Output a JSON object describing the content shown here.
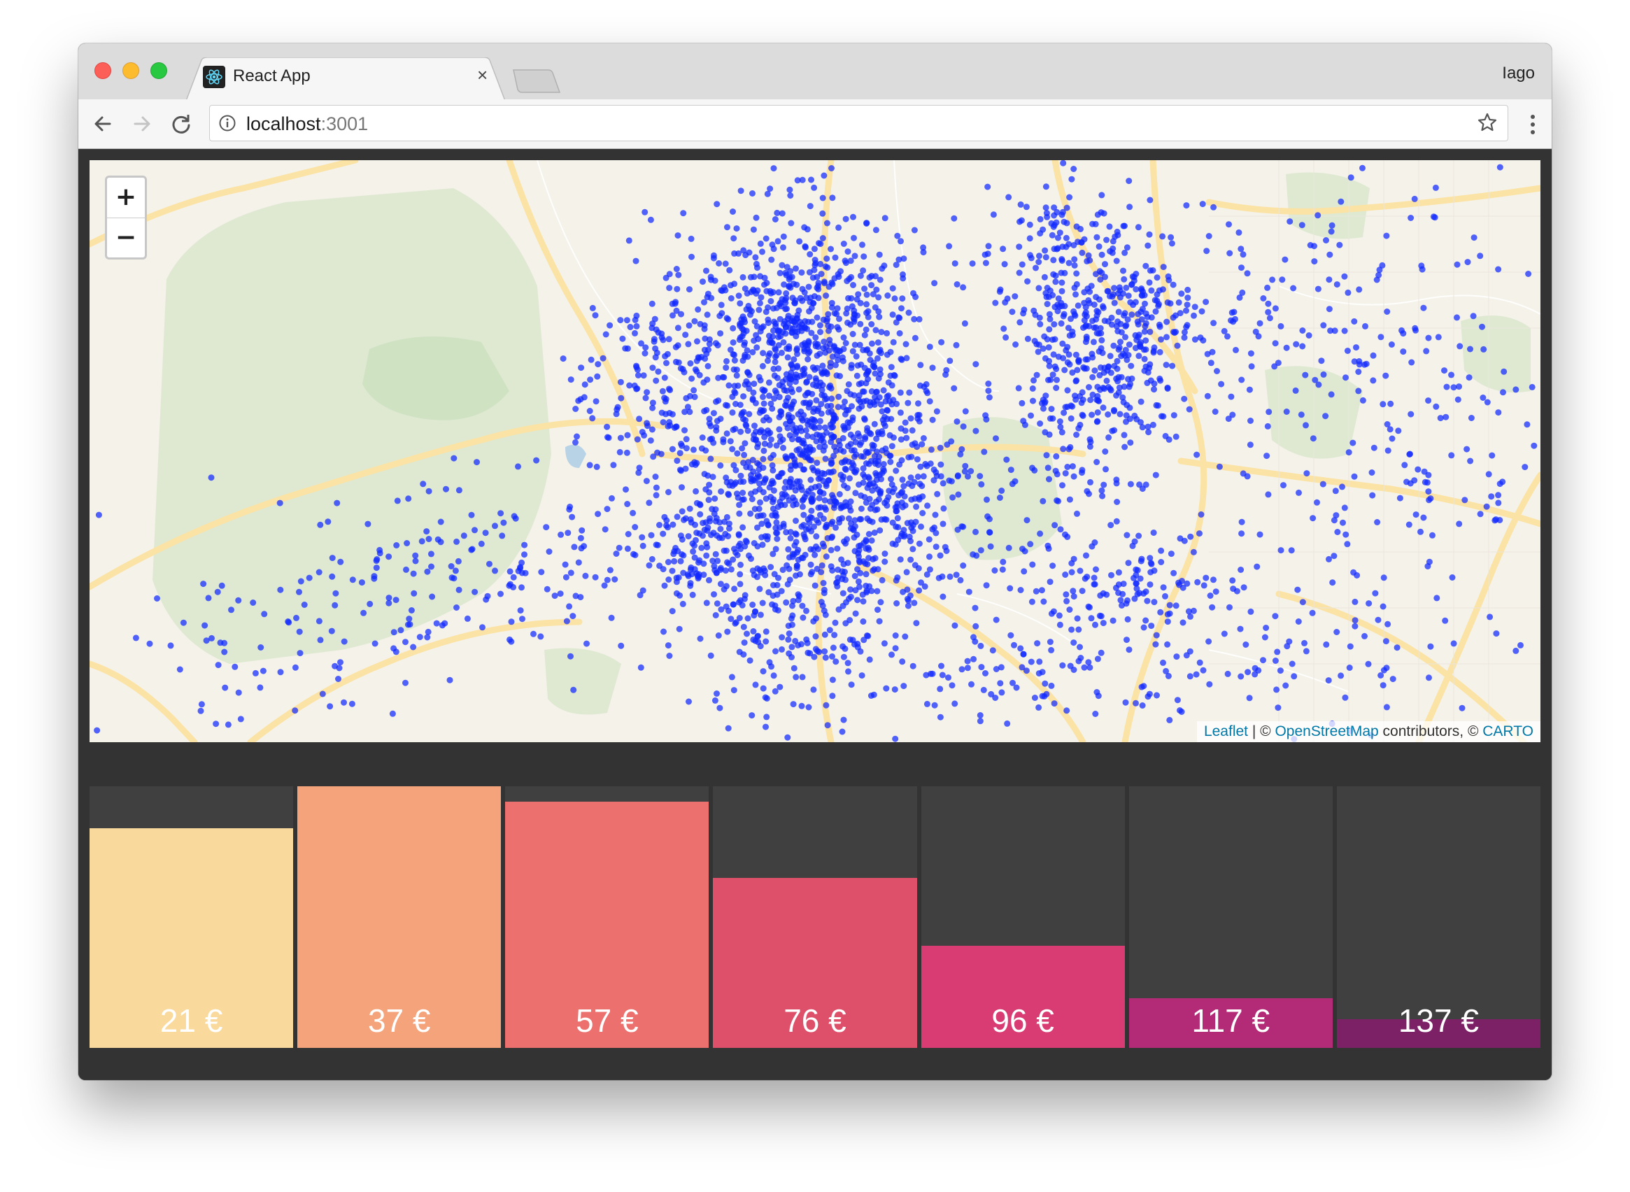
{
  "browser": {
    "tab_title": "React App",
    "tab_close": "×",
    "profile_name": "Iago",
    "url_host": "localhost",
    "url_port": ":3001"
  },
  "map": {
    "zoom_in": "+",
    "zoom_out": "−",
    "attribution": {
      "leaflet": "Leaflet",
      "sep1": " | © ",
      "osm": "OpenStreetMap",
      "middle": " contributors, © ",
      "carto": "CARTO"
    },
    "point_color": "#1028ff"
  },
  "price_bars": {
    "max_value": 100,
    "items": [
      {
        "label": "21 €",
        "fill_percent": 84,
        "color": "#f9d99c"
      },
      {
        "label": "37 €",
        "fill_percent": 100,
        "color": "#f5a37a"
      },
      {
        "label": "57 €",
        "fill_percent": 94,
        "color": "#ec716e"
      },
      {
        "label": "76 €",
        "fill_percent": 65,
        "color": "#de4f6a"
      },
      {
        "label": "96 €",
        "fill_percent": 39,
        "color": "#d83c73"
      },
      {
        "label": "117 €",
        "fill_percent": 19,
        "color": "#b32a76"
      },
      {
        "label": "137 €",
        "fill_percent": 11,
        "color": "#7d2167"
      }
    ]
  }
}
